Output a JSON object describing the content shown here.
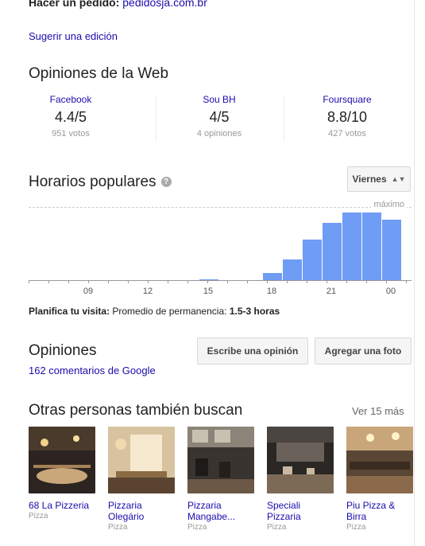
{
  "order": {
    "label": "Hacer un pedido:",
    "link": "pedidosja.com.br"
  },
  "suggest_edit": "Sugerir una edición",
  "web_reviews": {
    "title": "Opiniones de la Web",
    "sources": [
      {
        "name": "Facebook",
        "score": "4.4/5",
        "count": "951 votos"
      },
      {
        "name": "Sou BH",
        "score": "4/5",
        "count": "4 opiniones"
      },
      {
        "name": "Foursquare",
        "score": "8.8/10",
        "count": "427 votos"
      }
    ]
  },
  "popular_times": {
    "title": "Horarios populares",
    "info_icon": "info-icon",
    "day_selector": "Viernes",
    "max_label": "máximo",
    "tick_labels": [
      "09",
      "12",
      "15",
      "18",
      "21",
      "00"
    ],
    "bar_color": "#6f9cf5",
    "levels": [
      {
        "hour": "15",
        "level": 0.01
      },
      {
        "hour": "18",
        "level": 0.1
      },
      {
        "hour": "19",
        "level": 0.28
      },
      {
        "hour": "20",
        "level": 0.55
      },
      {
        "hour": "21",
        "level": 0.78
      },
      {
        "hour": "22",
        "level": 0.92
      },
      {
        "hour": "23",
        "level": 0.92
      },
      {
        "hour": "00",
        "level": 0.83
      }
    ]
  },
  "visit_plan": {
    "label": "Planifica tu visita:",
    "text": "Promedio de permanencia:",
    "value": "1.5-3 horas"
  },
  "opinions": {
    "title": "Opiniones",
    "write_button": "Escribe una opinión",
    "photo_button": "Agregar una foto",
    "google_comments": "162 comentarios de Google"
  },
  "others": {
    "title": "Otras personas también buscan",
    "more": "Ver 15 más",
    "items": [
      {
        "name": "68 La Pizzeria",
        "type": "Pizza"
      },
      {
        "name": "Pizzaria Olegário",
        "type": "Pizza"
      },
      {
        "name": "Pizzaria Mangabe...",
        "type": "Pizza"
      },
      {
        "name": "Speciali Pizzaria",
        "type": "Pizza"
      },
      {
        "name": "Piu Pizza & Birra",
        "type": "Pizza"
      }
    ]
  }
}
